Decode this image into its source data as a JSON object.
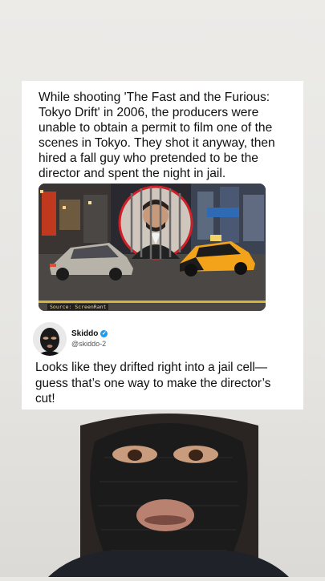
{
  "post": {
    "caption": "While shooting 'The Fast and the Furious: Tokyo Drift' in 2006, the producers were unable to obtain a permit to film one of the scenes in Tokyo. They shot it anyway, then hired a fall guy who pretended to be the director and spent the night in jail.",
    "image_source": "Source: ScreenRant"
  },
  "author": {
    "name": "Skiddo",
    "handle": "@skiddo-2",
    "verified_icon": "verified-badge-icon"
  },
  "comment": {
    "text": "Looks like they drifted right into a jail cell—guess that’s one way to make the director’s cut!"
  },
  "colors": {
    "card_background": "#ffffff",
    "page_background": "#e9e8e5",
    "verified_badge": "#1d9bf0",
    "jail_circle_border": "#d21f27"
  }
}
